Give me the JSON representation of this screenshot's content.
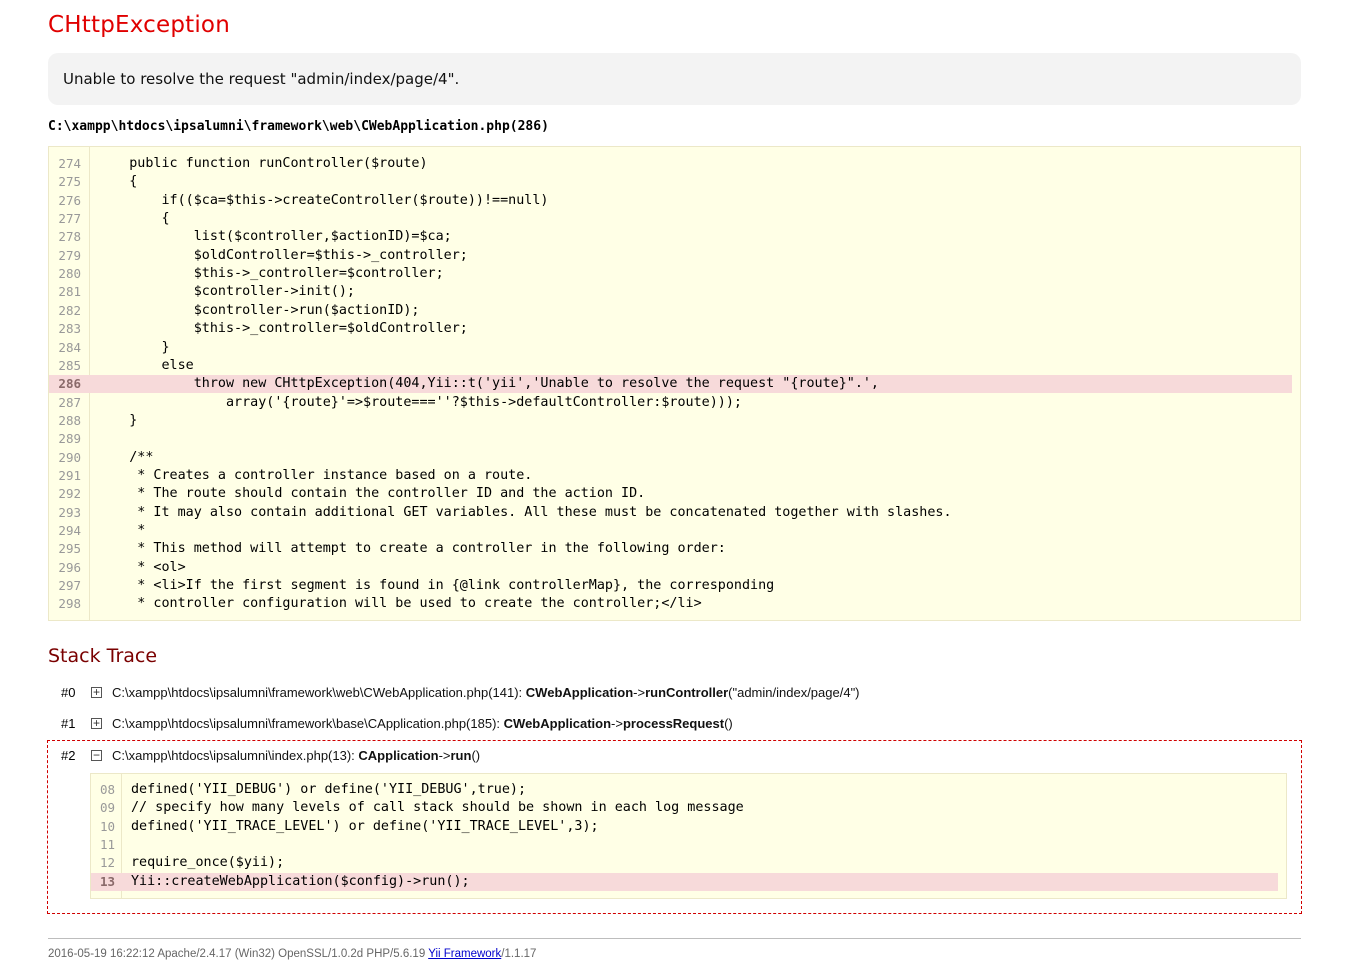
{
  "error": {
    "title": "CHttpException",
    "message": "Unable to resolve the request \"admin/index/page/4\".",
    "source_file": "C:\\xampp\\htdocs\\ipsalumni\\framework\\web\\CWebApplication.php(286)"
  },
  "source_code": {
    "highlight_line": "286",
    "lines": [
      {
        "n": "274",
        "code": "    public function runController($route)"
      },
      {
        "n": "275",
        "code": "    {"
      },
      {
        "n": "276",
        "code": "        if(($ca=$this->createController($route))!==null)"
      },
      {
        "n": "277",
        "code": "        {"
      },
      {
        "n": "278",
        "code": "            list($controller,$actionID)=$ca;"
      },
      {
        "n": "279",
        "code": "            $oldController=$this->_controller;"
      },
      {
        "n": "280",
        "code": "            $this->_controller=$controller;"
      },
      {
        "n": "281",
        "code": "            $controller->init();"
      },
      {
        "n": "282",
        "code": "            $controller->run($actionID);"
      },
      {
        "n": "283",
        "code": "            $this->_controller=$oldController;"
      },
      {
        "n": "284",
        "code": "        }"
      },
      {
        "n": "285",
        "code": "        else"
      },
      {
        "n": "286",
        "code": "            throw new CHttpException(404,Yii::t('yii','Unable to resolve the request \"{route}\".',"
      },
      {
        "n": "287",
        "code": "                array('{route}'=>$route===''?$this->defaultController:$route)));"
      },
      {
        "n": "288",
        "code": "    }"
      },
      {
        "n": "289",
        "code": ""
      },
      {
        "n": "290",
        "code": "    /**"
      },
      {
        "n": "291",
        "code": "     * Creates a controller instance based on a route."
      },
      {
        "n": "292",
        "code": "     * The route should contain the controller ID and the action ID."
      },
      {
        "n": "293",
        "code": "     * It may also contain additional GET variables. All these must be concatenated together with slashes."
      },
      {
        "n": "294",
        "code": "     *"
      },
      {
        "n": "295",
        "code": "     * This method will attempt to create a controller in the following order:"
      },
      {
        "n": "296",
        "code": "     * <ol>"
      },
      {
        "n": "297",
        "code": "     * <li>If the first segment is found in {@link controllerMap}, the corresponding"
      },
      {
        "n": "298",
        "code": "     * controller configuration will be used to create the controller;</li>"
      }
    ]
  },
  "stack_trace": {
    "title": "Stack Trace",
    "items": [
      {
        "num": "#0",
        "toggle": "+",
        "file": "C:\\xampp\\htdocs\\ipsalumni\\framework\\web\\CWebApplication.php(141): ",
        "class": "CWebApplication",
        "arrow": "->",
        "method": "runController",
        "args": "(\"admin/index/page/4\")"
      },
      {
        "num": "#1",
        "toggle": "+",
        "file": "C:\\xampp\\htdocs\\ipsalumni\\framework\\base\\CApplication.php(185): ",
        "class": "CWebApplication",
        "arrow": "->",
        "method": "processRequest",
        "args": "()"
      },
      {
        "num": "#2",
        "toggle": "−",
        "file": "C:\\xampp\\htdocs\\ipsalumni\\index.php(13): ",
        "class": "CApplication",
        "arrow": "->",
        "method": "run",
        "args": "()"
      }
    ],
    "expanded_code": {
      "highlight_line": "13",
      "lines": [
        {
          "n": "08",
          "code": "defined('YII_DEBUG') or define('YII_DEBUG',true);"
        },
        {
          "n": "09",
          "code": "// specify how many levels of call stack should be shown in each log message"
        },
        {
          "n": "10",
          "code": "defined('YII_TRACE_LEVEL') or define('YII_TRACE_LEVEL',3);"
        },
        {
          "n": "11",
          "code": ""
        },
        {
          "n": "12",
          "code": "require_once($yii);"
        },
        {
          "n": "13",
          "code": "Yii::createWebApplication($config)->run();"
        }
      ]
    }
  },
  "footer": {
    "text": "2016-05-19 16:22:12 Apache/2.4.17 (Win32) OpenSSL/1.0.2d PHP/5.6.19 ",
    "link_text": "Yii Framework",
    "version": "/1.1.17"
  },
  "colors": {
    "title": "#e00000",
    "stack_title": "#7a0000",
    "code_background": "#ffffe6",
    "highlight_background": "#f7dada",
    "expanded_border": "#d00000"
  }
}
